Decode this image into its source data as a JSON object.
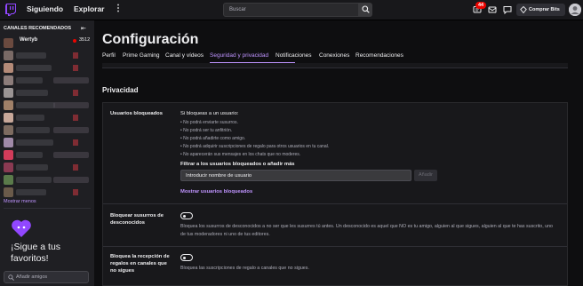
{
  "topnav": {
    "following": "Siguiendo",
    "browse": "Explorar",
    "more_icon": "kebab-menu-icon",
    "search_placeholder": "Buscar",
    "notifications_count": "44",
    "buy_bits": "Comprar Bits",
    "colors": {
      "brand": "#9147ff",
      "badge": "#eb0400"
    }
  },
  "sidebar": {
    "heading": "CANALES RECOMENDADOS",
    "first_channel": {
      "name": "Wertyb",
      "viewers": "3512"
    },
    "show_more": "Mostrar menos",
    "promo": "¡Sigue a tus favoritos!",
    "add_friends": "Añadir amigos"
  },
  "page": {
    "title": "Configuración",
    "tabs": [
      {
        "label": "Perfil"
      },
      {
        "label": "Prime Gaming"
      },
      {
        "label": "Canal y vídeos"
      },
      {
        "label": "Seguridad y privacidad",
        "active": true
      },
      {
        "label": "Notificaciones"
      },
      {
        "label": "Conexiones"
      },
      {
        "label": "Recomendaciones"
      }
    ],
    "section_title": "Privacidad"
  },
  "blocked": {
    "label": "Usuarios bloqueados",
    "intro": "Si bloqueas a un usuario:",
    "bullets": [
      "No podrá enviarte susurros.",
      "No podrá ser tu anfitrión.",
      "No podrá añadirte como amigo.",
      "No podrá adquirir suscripciones de regalo para otros usuarios en tu canal.",
      "No aparecerán sus mensajes en los chats que no moderes."
    ],
    "filter_label": "Filtrar a los usuarios bloqueados o añadir más",
    "filter_placeholder": "Introducir nombre de usuario",
    "add_button": "Añadir",
    "show_link": "Mostrar usuarios bloqueados"
  },
  "whispers": {
    "label": "Bloquear susurros de desconocidos",
    "enabled": false,
    "description": "Bloquea los susurros de desconocidos a no ser que les susurres tú antes. Un desconocido es aquel que NO es tu amigo, alguien al que sigues, alguien al que te has suscrito, uno de tus moderadores ni uno de tus editores."
  },
  "gifts": {
    "label": "Bloquea la recepción de regalos en canales que no sigues",
    "enabled": false,
    "description": "Bloquea las suscripciones de regalo a canales que no sigues."
  }
}
